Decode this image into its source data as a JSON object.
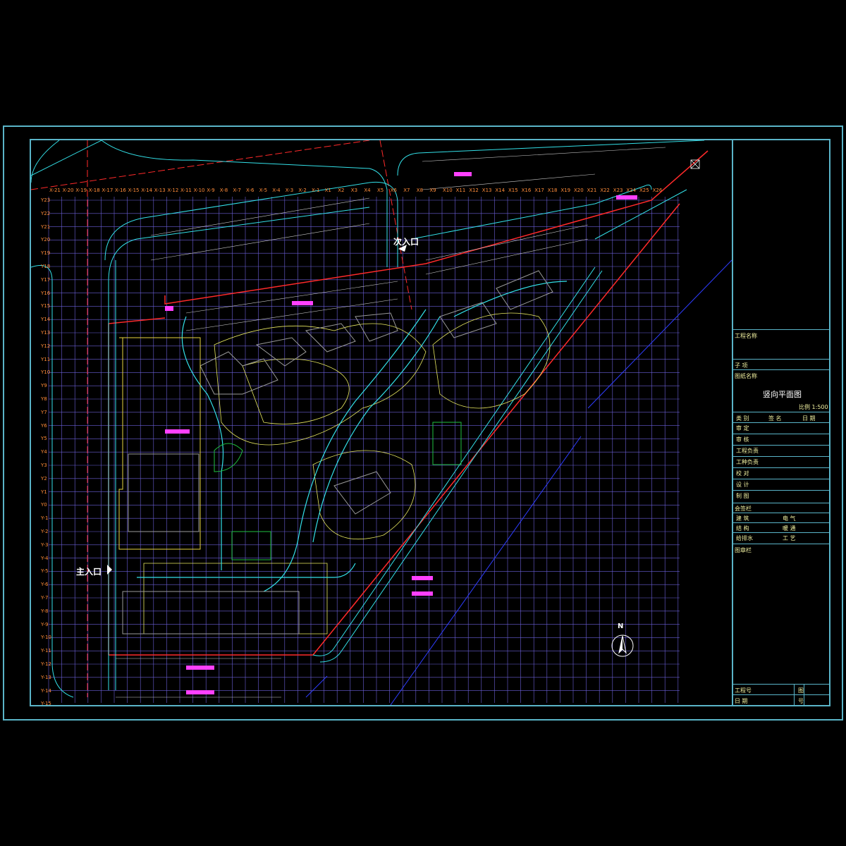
{
  "entrances": {
    "main": "主入口",
    "secondary": "次入口"
  },
  "drawing": {
    "north_letter": "N"
  },
  "title_block": {
    "project_name_label": "工程名称",
    "sub_item_label": "子  项",
    "drawing_name_label": "图纸名称",
    "drawing_name": "竖向平面图",
    "scale_text": "比例 1:500",
    "header_cols": [
      "类  别",
      "签  名",
      "日  期"
    ],
    "sign_rows": [
      "审  定",
      "审  核",
      "工程负责",
      "工种负责",
      "校  对",
      "设  计",
      "制  图"
    ],
    "countersign_label": "会签栏",
    "countersign_rows": [
      [
        "建  筑",
        "电  气"
      ],
      [
        "结  构",
        "暖  通"
      ],
      [
        "给排水",
        "工  艺"
      ]
    ],
    "stamp_label": "图章栏",
    "project_no_label": "工程号",
    "date_label": "日  期",
    "sheet_label": "图",
    "number_label": "号"
  },
  "x_axis_labels": [
    "X-21",
    "X-20",
    "X-19",
    "X-18",
    "X-17",
    "X-16",
    "X-15",
    "X-14",
    "X-13",
    "X-12",
    "X-11",
    "X-10",
    "X-9",
    "X-8",
    "X-7",
    "X-6",
    "X-5",
    "X-4",
    "X-3",
    "X-2",
    "X-1",
    "X1",
    "X2",
    "X3",
    "X4",
    "X5",
    "X6",
    "X7",
    "X8",
    "X9",
    "X10",
    "X11",
    "X12",
    "X13",
    "X14",
    "X15",
    "X16",
    "X17",
    "X18",
    "X19",
    "X20",
    "X21",
    "X22",
    "X23",
    "X24",
    "X25",
    "X26"
  ],
  "y_axis_labels": [
    "Y23",
    "Y22",
    "Y21",
    "Y20",
    "Y19",
    "Y18",
    "Y17",
    "Y16",
    "Y15",
    "Y14",
    "Y13",
    "Y12",
    "Y11",
    "Y10",
    "Y9",
    "Y8",
    "Y7",
    "Y6",
    "Y5",
    "Y4",
    "Y3",
    "Y2",
    "Y1",
    "Y0",
    "Y-1",
    "Y-2",
    "Y-3",
    "Y-4",
    "Y-5",
    "Y-6",
    "Y-7",
    "Y-8",
    "Y-9",
    "Y-10",
    "Y-11",
    "Y-12",
    "Y-13",
    "Y-14",
    "Y-15"
  ],
  "colors": {
    "frame": "#5ab4c8",
    "grid": "#6b5fd8",
    "red_line": "#ff2a2a",
    "cyan_line": "#33e0e8",
    "magenta_text": "#ff40ff",
    "yellow_line": "#e8e860",
    "axis_text": "#ff8c3a"
  }
}
